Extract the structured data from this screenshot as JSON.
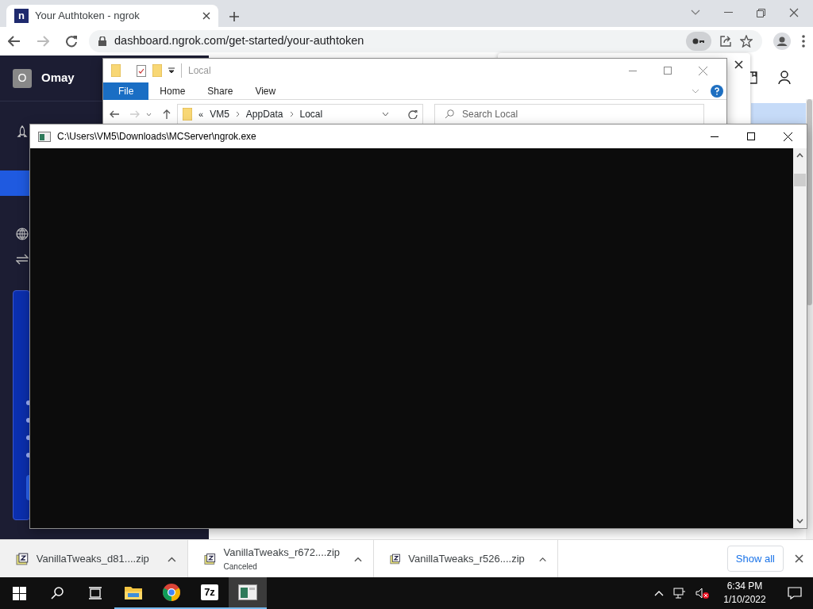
{
  "browser": {
    "favicon_letter": "n",
    "tab_title": "Your Authtoken - ngrok",
    "url": "dashboard.ngrok.com/get-started/your-authtoken"
  },
  "ngrok_sidebar": {
    "avatar_letter": "O",
    "user": "Omay"
  },
  "explorer": {
    "title": "Local",
    "ribbon_tabs": [
      {
        "label": "File",
        "selected": true
      },
      {
        "label": "Home",
        "selected": false
      },
      {
        "label": "Share",
        "selected": false
      },
      {
        "label": "View",
        "selected": false
      }
    ],
    "overflow_chevron": "«",
    "breadcrumb": [
      "VM5",
      "AppData",
      "Local"
    ],
    "search": {
      "placeholder": "Search Local"
    }
  },
  "console": {
    "title": "C:\\Users\\VM5\\Downloads\\MCServer\\ngrok.exe"
  },
  "downloads": [
    {
      "name": "VanillaTweaks_d81....zip",
      "hovered": true
    },
    {
      "name": "VanillaTweaks_r672....zip",
      "status": "Canceled",
      "hovered": false
    },
    {
      "name": "VanillaTweaks_r526....zip",
      "hovered": false
    }
  ],
  "show_all": "Show all",
  "taskbar": {
    "apps": [
      {
        "kind": "explorer",
        "selected": false
      },
      {
        "kind": "chrome",
        "selected": false
      },
      {
        "kind": "sevenzip",
        "label": "7z",
        "selected": false
      },
      {
        "kind": "console",
        "selected": true
      }
    ],
    "time": "6:34 PM",
    "date": "1/10/2022"
  }
}
